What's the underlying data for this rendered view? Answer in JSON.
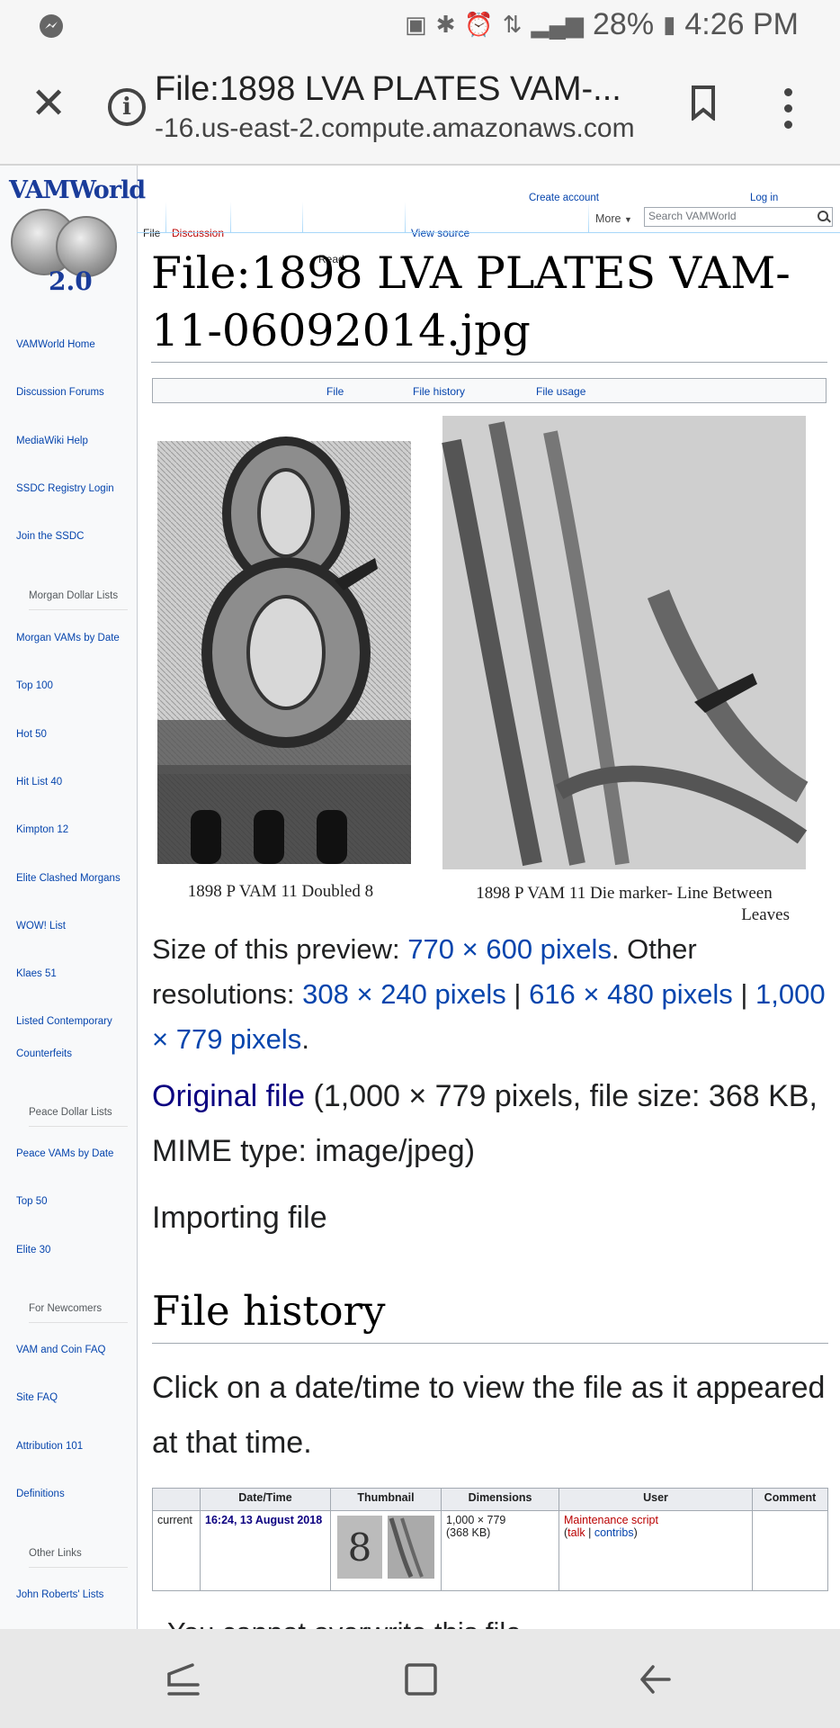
{
  "status_bar": {
    "battery": "28%",
    "time": "4:26 PM"
  },
  "browser": {
    "title": "File:1898 LVA PLATES VAM-...",
    "host": "-16.us-east-2.compute.amazonaws.com"
  },
  "logo": {
    "name": "VAMWorld",
    "version": "2.0"
  },
  "sidebar": {
    "main": [
      "VAMWorld Home",
      "Discussion Forums",
      "MediaWiki Help",
      "SSDC Registry Login",
      "Join the SSDC"
    ],
    "morgan_heading": "Morgan Dollar Lists",
    "morgan": [
      "Morgan VAMs by Date",
      "Top 100",
      "Hot 50",
      "Hit List 40",
      "Kimpton 12",
      "Elite Clashed Morgans",
      "WOW! List",
      "Klaes 51",
      "Listed Contemporary",
      "Counterfeits"
    ],
    "peace_heading": "Peace Dollar Lists",
    "peace": [
      "Peace VAMs by Date",
      "Top 50",
      "Elite 30"
    ],
    "newcomers_heading": "For Newcomers",
    "newcomers": [
      "VAM and Coin FAQ",
      "Site FAQ",
      "Attribution 101",
      "Definitions"
    ],
    "other_heading": "Other Links",
    "other": [
      "John Roberts' Lists"
    ]
  },
  "personal": {
    "create_account": "Create account",
    "login": "Log in"
  },
  "tabs": {
    "file": "File",
    "discussion": "Discussion",
    "read": "Read",
    "view_source": "View source",
    "more": "More"
  },
  "search": {
    "placeholder": "Search VAMWorld"
  },
  "page": {
    "title": "File:1898 LVA PLATES VAM-11-06092014.jpg",
    "toc": [
      "File",
      "File history",
      "File usage"
    ],
    "captions": {
      "left": "1898 P VAM 11 Doubled 8",
      "right_1": "1898 P VAM 11 Die marker- Line Between",
      "right_2": "Leaves"
    },
    "size_prefix": "Size of this preview: ",
    "size_preview": "770 × 600 pixels",
    "size_other": ". Other resolutions: ",
    "res1": "308 × 240 pixels",
    "res2": "616 × 480 pixels",
    "res3": "1,000 × 779 pixels",
    "sep": " | ",
    "period": ".",
    "original_link": "Original file",
    "original_info": " (1,000 × 779 pixels, file size: 368 KB, MIME type: image/jpeg)",
    "importing": "Importing file",
    "history_heading": "File history",
    "history_note": "Click on a date/time to view the file as it appeared at that time.",
    "cut_text": "You cannot overwrite this file."
  },
  "history_table": {
    "headers": [
      "",
      "Date/Time",
      "Thumbnail",
      "Dimensions",
      "User",
      "Comment"
    ],
    "row": {
      "status": "current",
      "datetime": "16:24, 13 August 2018",
      "dimensions": "1,000 × 779",
      "size": "(368 KB)",
      "user": "Maintenance script",
      "talk": "talk",
      "contribs": "contribs"
    }
  }
}
